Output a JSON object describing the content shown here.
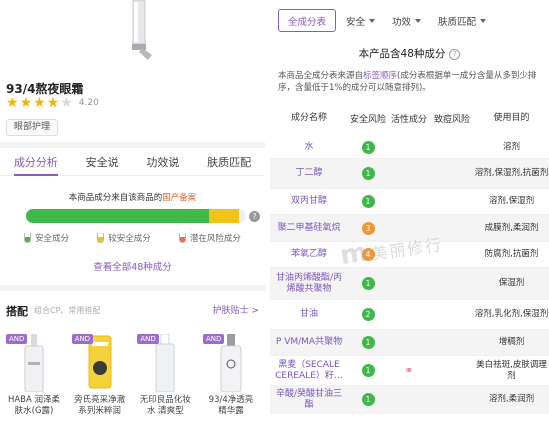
{
  "product": {
    "title": "93/4熬夜眼霜",
    "rating": 4.2,
    "rating_text": "4.20",
    "category_tag": "眼部护理"
  },
  "tabs": [
    "成分分析",
    "安全说",
    "功效说",
    "肤质匹配"
  ],
  "analysis": {
    "source_prefix": "本商品成分来自该商品的",
    "source_highlight": "国产备案",
    "safety_fraction": {
      "safe": 0.83,
      "warning": 0.14
    },
    "legend": [
      {
        "label": "安全成分",
        "color": "#3fb84a"
      },
      {
        "label": "较安全成分",
        "color": "#f2c21b"
      },
      {
        "label": "潜在风险成分",
        "color": "#ef6b5a"
      }
    ],
    "view_all": "查看全部48种成分",
    "help_glyph": "?"
  },
  "combo": {
    "title": "搭配",
    "subtitle": "组合CP、常用搭配",
    "link": "护肤贴士 >",
    "and_badge": "AND",
    "items": [
      {
        "name_line1": "HABA 润泽柔",
        "name_line2": "肤水(G露)"
      },
      {
        "name_line1": "旁氏亮采净澈",
        "name_line2": "系列米粹润"
      },
      {
        "name_line1": "无印良品化妆",
        "name_line2": "水 清爽型"
      },
      {
        "name_line1": "93/4净透亮",
        "name_line2": "精华露"
      }
    ]
  },
  "filters": {
    "all": "全成分表",
    "safety": "安全",
    "efficacy": "功效",
    "skin": "肤质匹配"
  },
  "ingredients_header": {
    "count_text": "本产品含48种成分",
    "help_glyph": "?",
    "desc_before": "本商品全成分表来源自",
    "desc_highlight": "标签顺序",
    "desc_after": "(成分表根据单一成分含量从多到少排序，含量低于1%的成分可以随意排列)。"
  },
  "table": {
    "columns": [
      "成分名称",
      "安全风险",
      "活性成分",
      "致痘风险",
      "使用目的"
    ],
    "rows": [
      {
        "name": "水",
        "safety": 1,
        "level": "green",
        "active": false,
        "purpose": "溶剂"
      },
      {
        "name": "丁二醇",
        "safety": 1,
        "level": "green",
        "active": false,
        "purpose": "溶剂,保湿剂,抗菌剂"
      },
      {
        "name": "双丙甘醇",
        "safety": 1,
        "level": "green",
        "active": false,
        "purpose": "溶剂,保湿剂"
      },
      {
        "name": "聚二甲基硅氧烷",
        "safety": 3,
        "level": "orange",
        "active": false,
        "purpose": "成膜剂,柔润剂"
      },
      {
        "name": "苯氧乙醇",
        "safety": 4,
        "level": "orange",
        "active": false,
        "purpose": "防腐剂,抗菌剂"
      },
      {
        "name": "甘油丙烯酸酯/丙烯酸共聚物",
        "safety": 1,
        "level": "green",
        "active": false,
        "purpose": "保湿剂"
      },
      {
        "name": "甘油",
        "safety": 2,
        "level": "green",
        "active": false,
        "purpose": "溶剂,乳化剂,保湿剂"
      },
      {
        "name": "P VM/MA共聚物",
        "safety": 1,
        "level": "green",
        "active": false,
        "purpose": "增稠剂"
      },
      {
        "name": "黑麦（SECALE CEREALE）籽…",
        "safety": 1,
        "level": "green",
        "active": true,
        "purpose": "美白祛斑,皮肤调理剂"
      },
      {
        "name": "辛酸/癸酸甘油三酯",
        "safety": 1,
        "level": "green",
        "active": false,
        "purpose": "溶剂,柔润剂"
      }
    ]
  },
  "watermark": {
    "glyph": "m",
    "text": "美丽修行"
  },
  "colors": {
    "accent": "#8a5ac2",
    "safe": "#3fb84a",
    "warn": "#f2c21b",
    "risk": "#ef6b5a",
    "level_orange": "#f0973a",
    "highlight_orange": "#e0692f"
  }
}
